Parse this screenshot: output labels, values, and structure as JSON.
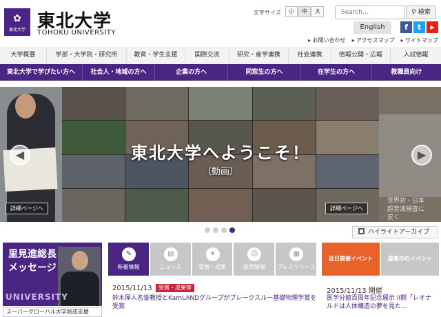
{
  "header": {
    "logo_jp": "東北大学",
    "logo_en": "TOHOKU UNIVERSITY",
    "seal_text": "東北大学",
    "font_size_label": "文字サイズ",
    "font_sizes": [
      "小",
      "中",
      "大"
    ],
    "search_placeholder": "Search...",
    "search_button": "検索",
    "english_button": "English",
    "util_links": [
      "お問い合わせ",
      "アクセスマップ",
      "サイトマップ"
    ]
  },
  "nav_primary": [
    "大学概要",
    "学部・大学院・研究所",
    "教育・学生支援",
    "国際交流",
    "研究・産学連携",
    "社会連携",
    "情報公開・広報",
    "入試情報"
  ],
  "nav_audience": [
    "東北大学で学びたい方へ",
    "社会人・地域の方へ",
    "企業の方へ",
    "同窓生の方へ",
    "在学生の方へ",
    "教職員向け"
  ],
  "hero": {
    "title": "東北大学へようこそ！",
    "subtitle": "（動画）",
    "detail_label": "詳細ページへ",
    "side_caption_1": "世界初・日本",
    "side_caption_2": "超音波検査に",
    "side_caption_3": "安く",
    "slides_total": 4,
    "slides_active": 4
  },
  "highlight_archive": "ハイライトアーカイブ",
  "president": {
    "line1": "里見進総長",
    "line2": "メッセージ",
    "univ_text": "UNIVERSITY"
  },
  "sgu_link": "スーパーグローバル大学創成支援",
  "news_tabs": [
    "新着情報",
    "ニュース",
    "受賞・成果",
    "採用情報",
    "プレスリリース"
  ],
  "news_item": {
    "date": "2015/11/13",
    "badge": "受賞・成果等",
    "text": "鈴木厚人名誉教授とKamLANDグループがブレークスルー基礎物理学賞を受賞"
  },
  "event_tabs": [
    "近日開催イベント",
    "募集中のイベント"
  ],
  "event_item": {
    "date": "2015/11/13 開催",
    "text": "医学分館百周年記念展示 II期「レオナルドは人体構造の夢を見た..."
  },
  "colors": {
    "brand_purple": "#4b2583",
    "event_orange": "#e8622a",
    "badge_red": "#c8253a"
  }
}
